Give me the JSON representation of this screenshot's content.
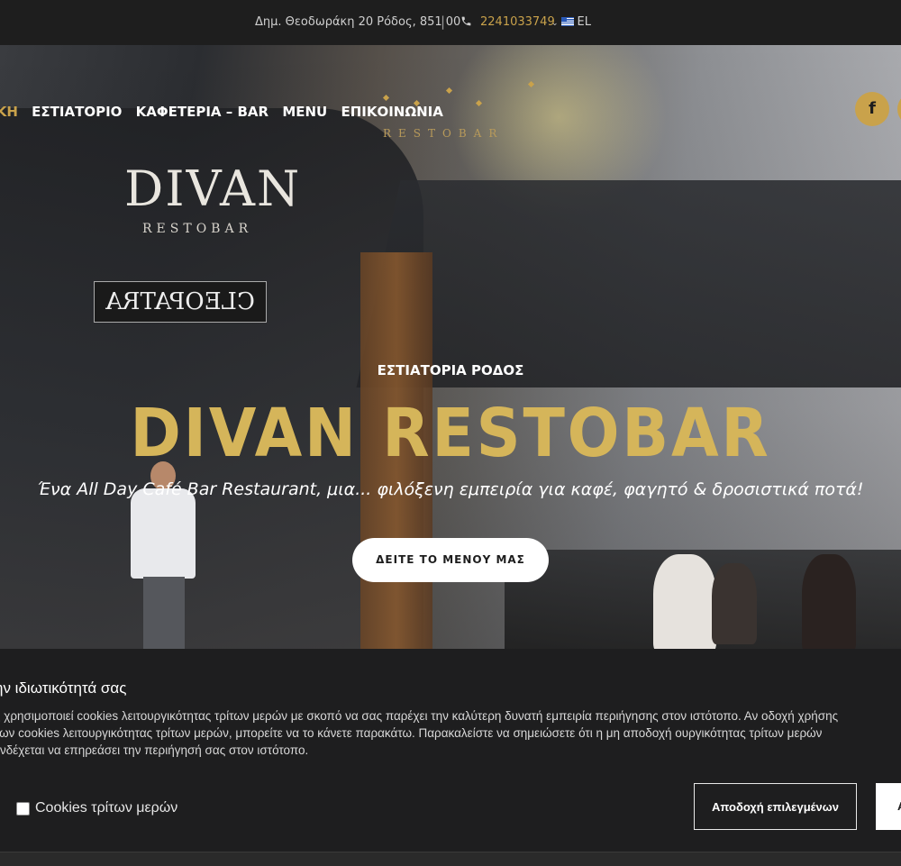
{
  "topbar": {
    "address": "Δημ. Θεοδωράκη 20 Ρόδος, 851 00",
    "separator": "|",
    "phone": "2241033749",
    "language": "EL"
  },
  "nav": {
    "items": [
      {
        "label": "ΑΡΧΙΚΗ",
        "active": true
      },
      {
        "label": "ΕΣΤΙΑΤΟΡΙΟ",
        "active": false
      },
      {
        "label": "ΚΑΦΕΤΕΡΙΑ – BAR",
        "active": false
      },
      {
        "label": "MENU",
        "active": false
      },
      {
        "label": "ΕΠΙΚΟΙΝΩΝΙΑ",
        "active": false
      }
    ]
  },
  "logo": {
    "text": "RESTOBAR"
  },
  "social": {
    "facebook_icon": "facebook-icon"
  },
  "hero": {
    "store_sign": "DIVAN",
    "store_sign_sub": "RESTOBAR",
    "cleo_sign": "CLEOPATRA",
    "eyebrow": "ΕΣΤΙΑΤΟΡΙΑ ΡΟΔΟΣ",
    "headline": "DIVAN RESTOBAR",
    "tagline": "Ένα All Day Café Bar Restaurant, μια... φιλόξενη εμπειρία για καφέ, φαγητό & δροσιστικά ποτά!",
    "cta_label": "ΔΕΙΤΕ ΤΟ ΜΕΝΟΥ ΜΑΣ"
  },
  "cookie": {
    "title": "ην ιδιωτικότητά σας",
    "text": "ς χρησιμοποιεί cookies λειτουργικότητας τρίτων μερών με σκοπό να σας παρέχει την καλύτερη δυνατή εμπειρία περιήγησης στον ιστότοπο. Αν οδοχή χρήσης των cookies λειτουργικότητας τρίτων μερών, μπορείτε να το κάνετε παρακάτω. Παρακαλείστε να σημειώσετε ότι η μη αποδοχή ουργικότητας τρίτων μερών ενδέχεται να επηρεάσει την περιήγησή σας στον ιστότοπο.",
    "checkbox_label": "Cookies τρίτων μερών",
    "accept_selected_label": "Αποδοχή επιλεγμένων",
    "accept_all_label": "Α"
  },
  "colors": {
    "accent": "#c9a24b",
    "headline": "#d5b55a",
    "topbar_bg": "#1e1e1e",
    "cookie_bg": "#1e1e1f"
  }
}
